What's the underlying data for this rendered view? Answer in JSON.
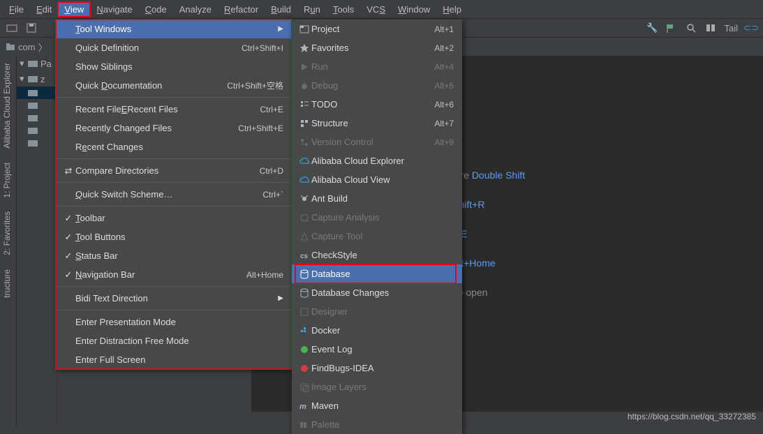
{
  "menubar": [
    {
      "label": "File",
      "u": "F"
    },
    {
      "label": "Edit",
      "u": "E"
    },
    {
      "label": "View",
      "u": "V",
      "selected": true
    },
    {
      "label": "Navigate",
      "u": "N"
    },
    {
      "label": "Code",
      "u": "C"
    },
    {
      "label": "Analyze",
      "u": ""
    },
    {
      "label": "Refactor",
      "u": "R"
    },
    {
      "label": "Build",
      "u": "B"
    },
    {
      "label": "Run",
      "u": "u"
    },
    {
      "label": "Tools",
      "u": "T"
    },
    {
      "label": "VCS",
      "u": "S"
    },
    {
      "label": "Window",
      "u": "W"
    },
    {
      "label": "Help",
      "u": "H"
    }
  ],
  "toolbar_right": {
    "tail": "Tail"
  },
  "breadcrumb": {
    "item": "com",
    "chevron": "〉"
  },
  "left_tools": [
    "Alibaba Cloud Explorer",
    "1: Project",
    "2: Favorites",
    "tructure"
  ],
  "project_rows": [
    "Pa",
    "z",
    "",
    "",
    "",
    "",
    ""
  ],
  "view_menu": [
    {
      "label": "Tool Windows",
      "u": "T",
      "highlight": true,
      "submenu": true
    },
    {
      "label": "Quick Definition",
      "shortcut": "Ctrl+Shift+I"
    },
    {
      "label": "Show Siblings"
    },
    {
      "label": "Quick Documentation",
      "u": "D",
      "shortcut": "Ctrl+Shift+空格"
    },
    {
      "sep": true
    },
    {
      "label": "Recent Files",
      "u": "E",
      "shortcut": "Ctrl+E"
    },
    {
      "label": "Recently Changed Files",
      "shortcut": "Ctrl+Shift+E"
    },
    {
      "label": "Recent Changes",
      "u": "e"
    },
    {
      "sep": true
    },
    {
      "label": "Compare Directories",
      "shortcut": "Ctrl+D",
      "icon": "compare"
    },
    {
      "sep": true
    },
    {
      "label": "Quick Switch Scheme…",
      "u": "Q",
      "shortcut": "Ctrl+`"
    },
    {
      "sep": true
    },
    {
      "label": "Toolbar",
      "u": "T",
      "check": true
    },
    {
      "label": "Tool Buttons",
      "u": "T",
      "check": true
    },
    {
      "label": "Status Bar",
      "u": "S",
      "check": true
    },
    {
      "label": "Navigation Bar",
      "u": "N",
      "check": true,
      "shortcut": "Alt+Home"
    },
    {
      "sep": true
    },
    {
      "label": "Bidi Text Direction",
      "submenu": true
    },
    {
      "sep": true
    },
    {
      "label": "Enter Presentation Mode"
    },
    {
      "label": "Enter Distraction Free Mode"
    },
    {
      "label": "Enter Full Screen"
    }
  ],
  "tool_windows": [
    {
      "label": "Project",
      "shortcut": "Alt+1",
      "icon": "project"
    },
    {
      "label": "Favorites",
      "shortcut": "Alt+2",
      "icon": "star"
    },
    {
      "label": "Run",
      "shortcut": "Alt+4",
      "icon": "play",
      "dim": true
    },
    {
      "label": "Debug",
      "shortcut": "Alt+5",
      "icon": "bug",
      "dim": true
    },
    {
      "label": "TODO",
      "shortcut": "Alt+6",
      "icon": "todo"
    },
    {
      "label": "Structure",
      "shortcut": "Alt+7",
      "icon": "structure"
    },
    {
      "label": "Version Control",
      "shortcut": "Alt+9",
      "icon": "vcs",
      "dim": true
    },
    {
      "label": "Alibaba Cloud Explorer",
      "icon": "cloud"
    },
    {
      "label": "Alibaba Cloud View",
      "icon": "cloud"
    },
    {
      "label": "Ant Build",
      "icon": "ant"
    },
    {
      "label": "Capture Analysis",
      "icon": "capture",
      "dim": true
    },
    {
      "label": "Capture Tool",
      "icon": "capturetool",
      "dim": true
    },
    {
      "label": "CheckStyle",
      "icon": "cs"
    },
    {
      "label": "Database",
      "icon": "db",
      "highlight": true
    },
    {
      "label": "Database Changes",
      "icon": "dbchanges"
    },
    {
      "label": "Designer",
      "icon": "designer",
      "dim": true
    },
    {
      "label": "Docker",
      "icon": "docker"
    },
    {
      "label": "Event Log",
      "icon": "event"
    },
    {
      "label": "FindBugs-IDEA",
      "icon": "findbugs"
    },
    {
      "label": "Image Layers",
      "icon": "layers",
      "dim": true
    },
    {
      "label": "Maven",
      "icon": "maven"
    },
    {
      "label": "Palette",
      "icon": "palette",
      "dim": true
    }
  ],
  "editor_hints": [
    {
      "suffix": "/here",
      "kb": "Double Shift"
    },
    {
      "suffix": "",
      "kb": "+Shift+R"
    },
    {
      "suffix": "",
      "kb": "trl+E"
    },
    {
      "suffix": "r",
      "kb": "Alt+Home"
    },
    {
      "suffix": "e to open",
      "kb": ""
    }
  ],
  "watermark": "https://blog.csdn.net/qq_33272385"
}
